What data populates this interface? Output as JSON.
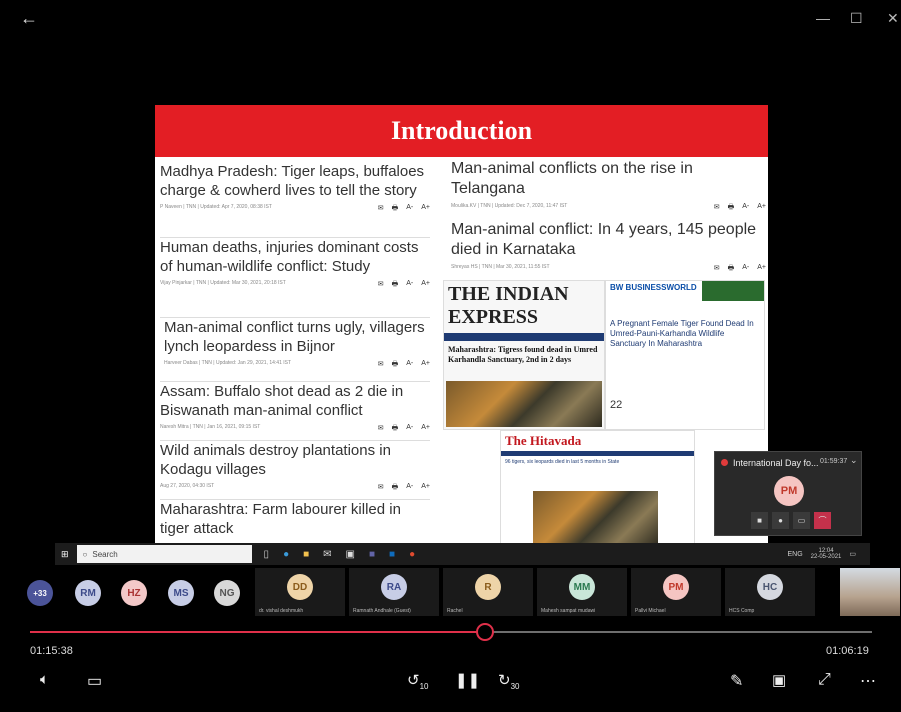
{
  "window": {
    "back_icon": "←",
    "minimize_icon": "—",
    "maximize_icon": "☐",
    "close_icon": "✕"
  },
  "slide": {
    "title": "Introduction",
    "left_articles": [
      {
        "headline": "Madhya Pradesh: Tiger leaps, buffaloes charge & cowherd lives to tell the story",
        "meta": "P Naveen | TNN | Updated: Apr 7, 2020, 08:38 IST"
      },
      {
        "headline": "Human deaths, injuries dominant costs of human-wildlife conflict: Study",
        "meta": "Vijay Pinjarkar | TNN | Updated: Mar 30, 2021, 20:18 IST"
      },
      {
        "headline": "Man-animal conflict turns ugly, villagers lynch leopardess in Bijnor",
        "meta": "Harveer Dabas | TNN | Updated: Jan 29, 2021, 14:41 IST"
      },
      {
        "headline": "Assam: Buffalo shot dead as 2 die in Biswanath man-animal conflict",
        "meta": "Naresh Mitra | TNN | Jan 16, 2021, 09:15 IST"
      },
      {
        "headline": "Wild animals destroy plantations in Kodagu villages",
        "meta": "Aug 27, 2020, 04:30 IST"
      },
      {
        "headline": "Maharashtra: Farm labourer killed in tiger attack",
        "meta": ""
      }
    ],
    "right_articles": [
      {
        "headline": "Man-animal conflicts on the rise in Telangana",
        "meta": "Moulika.KV | TNN | Updated: Dec 7, 2020, 11:47 IST"
      },
      {
        "headline": "Man-animal conflict: In 4 years, 145 people died in Karnataka",
        "meta": "Shreyas HS | TNN | Mar 30, 2021, 11:55 IST"
      }
    ],
    "share_icons": [
      "✉",
      "🖶",
      "A-",
      "A+"
    ],
    "clip_ie": {
      "logo": "THE INDIAN EXPRESS",
      "headline": "Maharashtra: Tigress found dead in Umred Karhandla Sanctuary, 2nd in 2 days"
    },
    "clip_bw": {
      "logo": "BW BUSINESSWORLD",
      "headline": "A Pregnant Female Tiger Found Dead In Umred-Pauni-Karhandla Wildlife Sanctuary In Maharashtra",
      "date": "22"
    },
    "clip_hv": {
      "logo": "The Hitavada",
      "headline": "96 tigers, six leopards died in last 5 months in State"
    }
  },
  "meeting_popup": {
    "title": "International Day fo...",
    "timer": "01:59:37",
    "avatar": "PM",
    "chevron": "⌄"
  },
  "taskbar": {
    "search_placeholder": "Search",
    "tray_lang": "ENG",
    "tray_time": "12:04",
    "tray_date": "22-05-2021"
  },
  "participants": {
    "overflow": "+33",
    "small": [
      {
        "initials": "RM",
        "color": "#c7cde6",
        "fg": "#3c4a8a"
      },
      {
        "initials": "HZ",
        "color": "#f3c8c8",
        "fg": "#a33"
      },
      {
        "initials": "MS",
        "color": "#c7cde6",
        "fg": "#3c4a8a"
      },
      {
        "initials": "NG",
        "color": "#d8d8d8",
        "fg": "#555"
      }
    ],
    "tiles": [
      {
        "initials": "DD",
        "name": "dr. vishal deshmukh",
        "color": "#eed4a8",
        "fg": "#8a5c1c"
      },
      {
        "initials": "RA",
        "name": "Ramnath Andhale (Guest)",
        "color": "#c7cde6",
        "fg": "#3c4a8a"
      },
      {
        "initials": "R",
        "name": "Rachel",
        "color": "#eed4a8",
        "fg": "#8a5c1c"
      },
      {
        "initials": "MM",
        "name": "Mahesh sampat mudawi",
        "color": "#c9e6d8",
        "fg": "#2a7a50"
      },
      {
        "initials": "PM",
        "name": "Pallvi Michael",
        "color": "#f5c5c2",
        "fg": "#c0392b"
      },
      {
        "initials": "HC",
        "name": "HCS Comp",
        "color": "#d5d8e0",
        "fg": "#4a5570"
      }
    ]
  },
  "player": {
    "elapsed": "01:15:38",
    "remaining": "01:06:19",
    "progress": 0.54,
    "rewind_label": "10",
    "forward_label": "30",
    "volume_icon": "volume-icon",
    "captions_icon": "captions-icon"
  }
}
